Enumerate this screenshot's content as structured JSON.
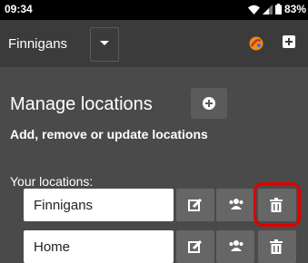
{
  "status_bar": {
    "time": "09:34",
    "battery": "83%",
    "icons": [
      "wifi-icon",
      "signal-icon",
      "battery-icon"
    ]
  },
  "app_bar": {
    "location_name": "Finnigans",
    "icons": [
      "chevron-down-icon",
      "app-logo-icon",
      "add-icon"
    ]
  },
  "main": {
    "title": "Manage locations",
    "subtitle": "Add, remove or update locations",
    "list_label": "Your locations:",
    "add_button_icon": "plus-circle-icon",
    "locations": [
      {
        "name": "Finnigans",
        "actions": [
          "edit-icon",
          "users-icon",
          "trash-icon"
        ],
        "delete_highlighted": true
      },
      {
        "name": "Home",
        "actions": [
          "edit-icon",
          "users-icon",
          "trash-icon"
        ],
        "delete_highlighted": false
      }
    ]
  },
  "colors": {
    "background": "#4a4a4a",
    "app_bar": "#3b3b3b",
    "status_bar": "#000000",
    "button": "#666666",
    "highlight": "#e00000"
  }
}
